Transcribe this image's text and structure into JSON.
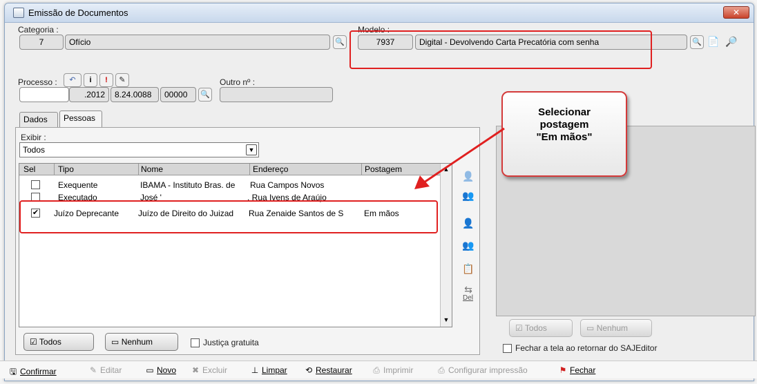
{
  "window": {
    "title": "Emissão de Documentos",
    "close": "✕"
  },
  "categoria": {
    "label": "Categoria :",
    "code": "7",
    "name": "Ofício"
  },
  "modelo": {
    "label": "Modelo :",
    "code": "7937",
    "name": "Digital - Devolvendo Carta Precatória com senha"
  },
  "processo": {
    "label": "Processo :",
    "parts": [
      "",
      ".2012",
      "8.24.0088",
      "00000"
    ],
    "outro_label": "Outro nº :",
    "outro_value": ""
  },
  "tabs": [
    {
      "label": "Dados"
    },
    {
      "label": "Pessoas"
    }
  ],
  "exibir": {
    "label": "Exibir :",
    "value": "Todos"
  },
  "grid": {
    "columns": [
      "Sel",
      "Tipo",
      "Nome",
      "Endereço",
      "Postagem"
    ],
    "rows": [
      {
        "checked": false,
        "tipo": "Exequente",
        "nome": "IBAMA - Instituto Bras. de",
        "endereco": "Rua Campos Novos",
        "postagem": ""
      },
      {
        "checked": false,
        "tipo": "Executado",
        "nome": "José '",
        "endereco": ". Rua Ivens de Araújo",
        "postagem": ""
      },
      {
        "checked": true,
        "tipo": "Juízo Deprecante",
        "nome": "Juízo de Direito do Juizad",
        "endereco": "Rua Zenaide Santos de S",
        "postagem": "Em mãos"
      }
    ],
    "check_mark": "✔"
  },
  "bottom_left": {
    "todos": "Todos",
    "nenhum": "Nenhum",
    "justica": "Justiça gratuita"
  },
  "right_panel": {
    "todos": "Todos",
    "nenhum": "Nenhum",
    "fechar_tela": "Fechar a tela ao retornar do SAJEditor"
  },
  "callout": {
    "line1": "Selecionar",
    "line2": "postagem",
    "line3": "\"Em mãos\""
  },
  "side_del": "Del",
  "toolbar": {
    "confirmar": "Confirmar",
    "editar": "Editar",
    "novo": "Novo",
    "excluir": "Excluir",
    "limpar": "Limpar",
    "restaurar": "Restaurar",
    "imprimir": "Imprimir",
    "configurar": "Configurar impressão",
    "fechar": "Fechar"
  },
  "colors": {
    "highlight": "#e02020",
    "titlebar": "#c8d8ec"
  }
}
